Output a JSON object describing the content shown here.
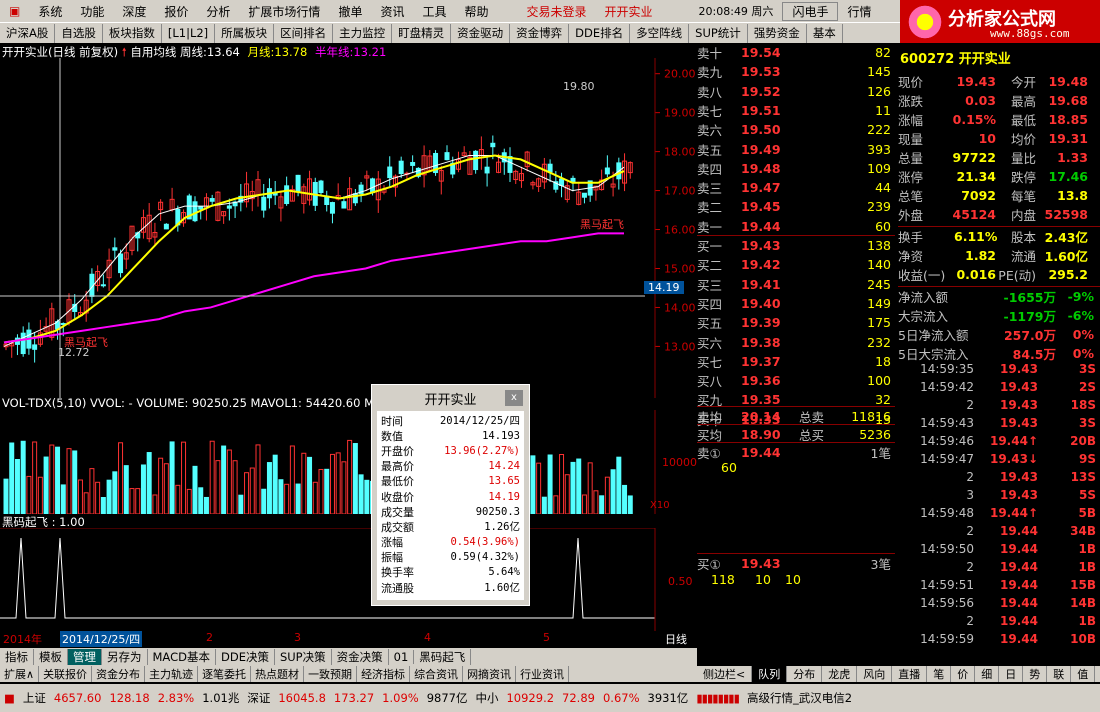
{
  "menu": [
    "系统",
    "功能",
    "深度",
    "报价",
    "分析",
    "扩展市场行情",
    "撤单",
    "资讯",
    "工具",
    "帮助"
  ],
  "menu_status": [
    "交易未登录",
    "开开实业"
  ],
  "clock": "20:08:49 周六",
  "menu_right": [
    "闪电手",
    "行情"
  ],
  "tabs": [
    "沪深A股",
    "自选股",
    "板块指数",
    "[L1|L2]",
    "所属板块",
    "区间排名",
    "主力监控",
    "盯盘精灵",
    "资金驱动",
    "资金博弈",
    "DDE排名",
    "多空阵线",
    "SUP统计",
    "强势资金",
    "基本"
  ],
  "logo": {
    "title": "分析家公式网",
    "url": "www.88gs.com"
  },
  "chart": {
    "title": "开开实业(日线 前复权)",
    "indicator": "自用均线",
    "week_label": "周线:",
    "week_val": "13.64",
    "month_label": "月线:",
    "month_val": "13.78",
    "half_label": "半年线:",
    "half_val": "13.21",
    "yaxis": [
      "20.00",
      "19.00",
      "18.00",
      "17.00",
      "16.00",
      "15.00",
      "14.00",
      "13.00"
    ],
    "cursor_price": "14.19",
    "high_mark": "19.80",
    "low_mark": "12.72",
    "signal": "黑马起飞",
    "vol_title": "VOL-TDX(5,10)  VVOL: -  VOLUME: 90250.25  MAVOL1: 54420.60  MA",
    "vol_axis": "10000",
    "vol_unit": "X10",
    "ind_title": "黑码起飞 : 1.00",
    "ind_axis": "0.50",
    "dates": [
      "2014年",
      "2014/12/25/四",
      "2",
      "3",
      "4",
      "5"
    ],
    "period": "日线"
  },
  "chart_data": {
    "type": "line",
    "title": "开开实业(日线 前复权)",
    "ylim": [
      12.6,
      20.3
    ],
    "series": [
      {
        "name": "周线",
        "values": [
          13.0,
          13.3,
          13.6,
          14.2,
          15.0,
          15.8,
          16.4,
          16.6,
          16.6,
          16.7,
          16.9,
          17.0,
          16.9,
          16.8,
          17.0,
          17.3,
          17.5,
          17.7,
          17.9,
          17.9,
          17.6,
          17.3,
          17.0,
          17.1,
          17.6
        ]
      },
      {
        "name": "月线",
        "values": [
          13.1,
          13.2,
          13.4,
          13.8,
          14.3,
          15.0,
          15.7,
          16.3,
          16.6,
          16.8,
          16.9,
          17.0,
          16.9,
          16.8,
          16.9,
          17.1,
          17.4,
          17.6,
          17.8,
          17.9,
          17.8,
          17.5,
          17.2,
          17.2,
          17.5
        ]
      },
      {
        "name": "半年线",
        "values": [
          13.1,
          13.2,
          13.3,
          13.4,
          13.5,
          13.6,
          13.7,
          13.9,
          14.0,
          14.2,
          14.4,
          14.6,
          14.8,
          14.9,
          15.0,
          15.2,
          15.3,
          15.4,
          15.5,
          15.6,
          15.7,
          15.7,
          15.8,
          15.9,
          15.9
        ]
      }
    ]
  },
  "quotes": {
    "sells": [
      {
        "label": "卖十",
        "price": "19.54",
        "vol": "82"
      },
      {
        "label": "卖九",
        "price": "19.53",
        "vol": "145"
      },
      {
        "label": "卖八",
        "price": "19.52",
        "vol": "126"
      },
      {
        "label": "卖七",
        "price": "19.51",
        "vol": "11"
      },
      {
        "label": "卖六",
        "price": "19.50",
        "vol": "222"
      },
      {
        "label": "卖五",
        "price": "19.49",
        "vol": "393"
      },
      {
        "label": "卖四",
        "price": "19.48",
        "vol": "109"
      },
      {
        "label": "卖三",
        "price": "19.47",
        "vol": "44"
      },
      {
        "label": "卖二",
        "price": "19.45",
        "vol": "239"
      },
      {
        "label": "卖一",
        "price": "19.44",
        "vol": "60"
      }
    ],
    "buys": [
      {
        "label": "买一",
        "price": "19.43",
        "vol": "138"
      },
      {
        "label": "买二",
        "price": "19.42",
        "vol": "140"
      },
      {
        "label": "买三",
        "price": "19.41",
        "vol": "245"
      },
      {
        "label": "买四",
        "price": "19.40",
        "vol": "149"
      },
      {
        "label": "买五",
        "price": "19.39",
        "vol": "175"
      },
      {
        "label": "买六",
        "price": "19.38",
        "vol": "232"
      },
      {
        "label": "买七",
        "price": "19.37",
        "vol": "18"
      },
      {
        "label": "买八",
        "price": "19.36",
        "vol": "100"
      },
      {
        "label": "买九",
        "price": "19.35",
        "vol": "32"
      },
      {
        "label": "买十",
        "price": "19.33",
        "vol": "13"
      }
    ],
    "avg_sell": {
      "label": "卖均",
      "price": "20.14",
      "k": "总卖",
      "v": "11816"
    },
    "avg_buy": {
      "label": "买均",
      "price": "18.90",
      "k": "总买",
      "v": "5236"
    },
    "ask1": {
      "label": "卖①",
      "price": "19.44",
      "count": "1笔",
      "detail": "60"
    },
    "bid1": {
      "label": "买①",
      "price": "19.43",
      "count": "3笔",
      "detail": [
        "118",
        "10",
        "10"
      ]
    }
  },
  "stock_code": "600272 开开实业",
  "stats": [
    {
      "l": "现价",
      "v": "19.43",
      "l2": "今开",
      "v2": "19.48"
    },
    {
      "l": "涨跌",
      "v": "0.03",
      "l2": "最高",
      "v2": "19.68"
    },
    {
      "l": "涨幅",
      "v": "0.15%",
      "l2": "最低",
      "v2": "18.85"
    },
    {
      "l": "现量",
      "v": "10",
      "l2": "均价",
      "v2": "19.31"
    },
    {
      "l": "总量",
      "v": "97722",
      "l2": "量比",
      "v2": "1.33"
    },
    {
      "l": "涨停",
      "v": "21.34",
      "l2": "跌停",
      "v2": "17.46"
    },
    {
      "l": "总笔",
      "v": "7092",
      "l2": "每笔",
      "v2": "13.8"
    },
    {
      "l": "外盘",
      "v": "45124",
      "l2": "内盘",
      "v2": "52598"
    }
  ],
  "stats2": [
    {
      "l": "换手",
      "v": "6.11%",
      "l2": "股本",
      "v2": "2.43亿"
    },
    {
      "l": "净资",
      "v": "1.82",
      "l2": "流通",
      "v2": "1.60亿"
    },
    {
      "l": "收益(一)",
      "v": "0.016",
      "l2": "PE(动)",
      "v2": "295.2"
    }
  ],
  "flows": [
    {
      "l": "净流入额",
      "v": "-1655万",
      "p": "-9%"
    },
    {
      "l": "大宗流入",
      "v": "-1179万",
      "p": "-6%"
    },
    {
      "l": "5日净流入额",
      "v": "257.0万",
      "p": "0%"
    },
    {
      "l": "5日大宗流入",
      "v": "84.5万",
      "p": "0%"
    }
  ],
  "ticks": [
    {
      "t": "14:59:35",
      "p": "19.43",
      "v": "3S"
    },
    {
      "t": "14:59:42",
      "p": "19.43",
      "v": "2S"
    },
    {
      "t": "2",
      "p": "19.43",
      "v": "18S"
    },
    {
      "t": "14:59:43",
      "p": "19.43",
      "v": "3S"
    },
    {
      "t": "14:59:46",
      "p": "19.44↑",
      "v": "20B"
    },
    {
      "t": "14:59:47",
      "p": "19.43↓",
      "v": "9S"
    },
    {
      "t": "2",
      "p": "19.43",
      "v": "13S"
    },
    {
      "t": "3",
      "p": "19.43",
      "v": "5S"
    },
    {
      "t": "14:59:48",
      "p": "19.44↑",
      "v": "5B"
    },
    {
      "t": "2",
      "p": "19.44",
      "v": "34B"
    },
    {
      "t": "14:59:50",
      "p": "19.44",
      "v": "1B"
    },
    {
      "t": "2",
      "p": "19.44",
      "v": "1B"
    },
    {
      "t": "14:59:51",
      "p": "19.44",
      "v": "15B"
    },
    {
      "t": "14:59:56",
      "p": "19.44",
      "v": "14B"
    },
    {
      "t": "2",
      "p": "19.44",
      "v": "1B"
    },
    {
      "t": "14:59:59",
      "p": "19.44",
      "v": "10B"
    }
  ],
  "popup": {
    "title": "开开实业",
    "close": "x",
    "rows": [
      {
        "k": "时间",
        "v": "2014/12/25/四"
      },
      {
        "k": "数值",
        "v": "14.193"
      },
      {
        "k": "开盘价",
        "v": "13.96(2.27%)"
      },
      {
        "k": "最高价",
        "v": "14.24"
      },
      {
        "k": "最低价",
        "v": "13.65"
      },
      {
        "k": "收盘价",
        "v": "14.19"
      },
      {
        "k": "成交量",
        "v": "90250.3"
      },
      {
        "k": "成交额",
        "v": "1.26亿"
      },
      {
        "k": "涨幅",
        "v": "0.54(3.96%)"
      },
      {
        "k": "振幅",
        "v": "0.59(4.32%)"
      },
      {
        "k": "换手率",
        "v": "5.64%"
      },
      {
        "k": "流通股",
        "v": "1.60亿"
      }
    ]
  },
  "bottom_tabs": [
    "指标",
    "模板",
    "管理",
    "另存为",
    "MACD基本",
    "DDE决策",
    "SUP决策",
    "资金决策",
    "01",
    "黑码起飞"
  ],
  "bottom_tabs2": [
    "扩展∧",
    "关联报价",
    "资金分布",
    "主力轨迹",
    "逐笔委托",
    "热点题材",
    "一致预期",
    "经济指标",
    "综合资讯",
    "网摘资讯",
    "行业资讯"
  ],
  "right_tabs": [
    "侧边栏<",
    "队列",
    "分布",
    "龙虎",
    "风向",
    "直播",
    "笔",
    "价",
    "细",
    "日",
    "势",
    "联",
    "值",
    "筹"
  ],
  "statusbar": {
    "sh_label": "上证",
    "sh_val": "4657.60",
    "sh_chg": "128.18",
    "sh_pct": "2.83%",
    "sh_amt": "1.01兆",
    "sz_label": "深证",
    "sz_val": "16045.8",
    "sz_chg": "173.27",
    "sz_pct": "1.09%",
    "sz_amt": "9877亿",
    "zx_label": "中小",
    "zx_val": "10929.2",
    "zx_chg": "72.89",
    "zx_pct": "0.67%",
    "zx_amt": "3931亿",
    "server": "高级行情_武汉电信2"
  }
}
